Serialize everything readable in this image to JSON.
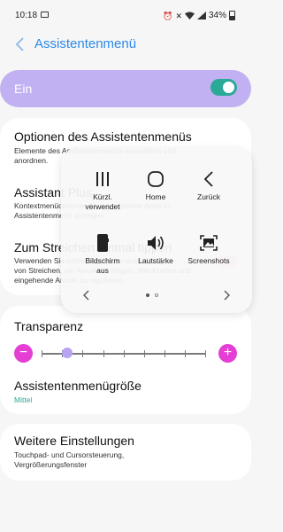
{
  "status_bar": {
    "time": "10:18",
    "battery": "34%"
  },
  "header": {
    "title": "Assistentenmenü"
  },
  "master_toggle": {
    "label": "Ein",
    "on": true
  },
  "settings": {
    "options_title": "Optionen des Assistentenmenüs",
    "options_sub_1": "Elemente des Assistentenmenüs auswählen und",
    "options_sub_2": "anordnen.",
    "assistant_plus_title": "Assistant Plus",
    "assistant_plus_sub_1": "Kontextmenüoptionen für ausgewählte Apps im",
    "assistant_plus_sub_2": "Assistentenmenü anzeigen.",
    "swipe_title": "Zum Streichen einmal tippen",
    "swipe_sub_1": "Verwenden Sie einfaches Tippen anstelle",
    "swipe_sub_2": "von Streichen, um Anrufe zu tätigen, Weckzeiten und",
    "swipe_sub_3": "eingehende Anrufe zu regulieren.",
    "transparency_title": "Transparenz",
    "transparency_level": 0.16,
    "minus_label": "−",
    "plus_label": "+",
    "size_title": "Assistentenmenügröße",
    "size_value": "Mittel",
    "more_title": "Weitere Einstellungen",
    "more_sub_1": "Touchpad- und Cursorsteuerung,",
    "more_sub_2": "Vergrößerungsfenster"
  },
  "assistant_panel": {
    "buttons": [
      {
        "label_1": "Kürzl.",
        "label_2": "verwendet",
        "icon": "recents-icon"
      },
      {
        "label_1": "Home",
        "label_2": "",
        "icon": "home-icon"
      },
      {
        "label_1": "Zurück",
        "label_2": "",
        "icon": "back-icon"
      },
      {
        "label_1": "Bildschirm",
        "label_2": "aus",
        "icon": "screen-off-icon"
      },
      {
        "label_1": "Lautstärke",
        "label_2": "",
        "icon": "volume-icon"
      },
      {
        "label_1": "Screenshots",
        "label_2": "",
        "icon": "screenshot-icon"
      }
    ],
    "page": 1,
    "page_count": 2
  },
  "colors": {
    "accent_blue": "#2b8ae8",
    "toggle_bg": "#c2b1f2",
    "switch_on": "#2aa997",
    "slider_buttons": "#e43ed4"
  }
}
